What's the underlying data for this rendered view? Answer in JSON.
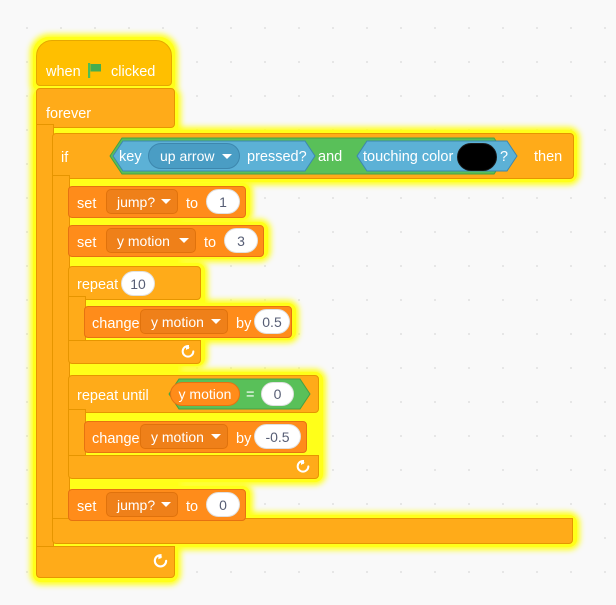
{
  "app": {
    "name": "Scratch Block Editor",
    "canvas_background": "#f9f9f9",
    "dot_grid_color": "#e6e6e6"
  },
  "palette": {
    "events": "#ffbf00",
    "control": "#ffab19",
    "data": "#ff8c1a",
    "sensing": "#5cb1d6",
    "operators": "#59c059",
    "glow": "#ffff1a",
    "text": "#ffffff",
    "value_text": "#575e75"
  },
  "script": {
    "name": "jump-script",
    "selected": true,
    "blocks": [
      {
        "id": "when-flag-clicked",
        "type": "hat",
        "category": "events",
        "label_before": "when",
        "icon": "green-flag-icon",
        "label_after": "clicked"
      },
      {
        "id": "forever",
        "type": "c-block",
        "category": "control",
        "label": "forever",
        "loop_icon": "loop-arrow-icon"
      },
      {
        "id": "if-then",
        "type": "c-block",
        "category": "control",
        "label_before": "if",
        "label_after": "then",
        "condition": {
          "id": "and-operator",
          "category": "operators",
          "label": "and",
          "left": {
            "id": "key-pressed",
            "category": "sensing",
            "label_before": "key",
            "dropdown_value": "up arrow",
            "label_after": "pressed?"
          },
          "right": {
            "id": "touching-color",
            "category": "sensing",
            "label_before": "touching color",
            "color_swatch": "#000000",
            "label_after": "?"
          }
        }
      },
      {
        "id": "set-jump-1",
        "type": "stack",
        "category": "data",
        "label_before": "set",
        "dropdown_value": "jump?",
        "label_mid": "to",
        "value": "1"
      },
      {
        "id": "set-ymotion-3",
        "type": "stack",
        "category": "data",
        "label_before": "set",
        "dropdown_value": "y motion",
        "label_mid": "to",
        "value": "3"
      },
      {
        "id": "repeat-10",
        "type": "c-block",
        "category": "control",
        "label": "repeat",
        "value": "10",
        "loop_icon": "loop-arrow-icon"
      },
      {
        "id": "change-ymotion-up",
        "type": "stack",
        "category": "data",
        "label_before": "change",
        "dropdown_value": "y motion",
        "label_mid": "by",
        "value": "0.5"
      },
      {
        "id": "repeat-until",
        "type": "c-block",
        "category": "control",
        "label": "repeat until",
        "loop_icon": "loop-arrow-icon",
        "condition": {
          "id": "equals-operator",
          "category": "operators",
          "operator": "=",
          "left_variable": "y motion",
          "right_value": "0"
        }
      },
      {
        "id": "change-ymotion-down",
        "type": "stack",
        "category": "data",
        "label_before": "change",
        "dropdown_value": "y motion",
        "label_mid": "by",
        "value": "-0.5"
      },
      {
        "id": "set-jump-0",
        "type": "stack",
        "category": "data",
        "label_before": "set",
        "dropdown_value": "jump?",
        "label_mid": "to",
        "value": "0"
      }
    ]
  },
  "text": {
    "when": "when",
    "clicked": "clicked",
    "forever": "forever",
    "if": "if",
    "then": "then",
    "key": "key",
    "up_arrow": "up arrow",
    "pressed": "pressed?",
    "and": "and",
    "touching_color": "touching color",
    "question": "?",
    "set": "set",
    "to": "to",
    "change": "change",
    "by": "by",
    "repeat": "repeat",
    "repeat_until": "repeat until",
    "jump_var": "jump?",
    "ymotion_var": "y motion",
    "equals": "=",
    "v_one": "1",
    "v_three": "3",
    "v_ten": "10",
    "v_halfpos": "0.5",
    "v_halfneg": "-0.5",
    "v_zero": "0",
    "v_zero2": "0"
  }
}
